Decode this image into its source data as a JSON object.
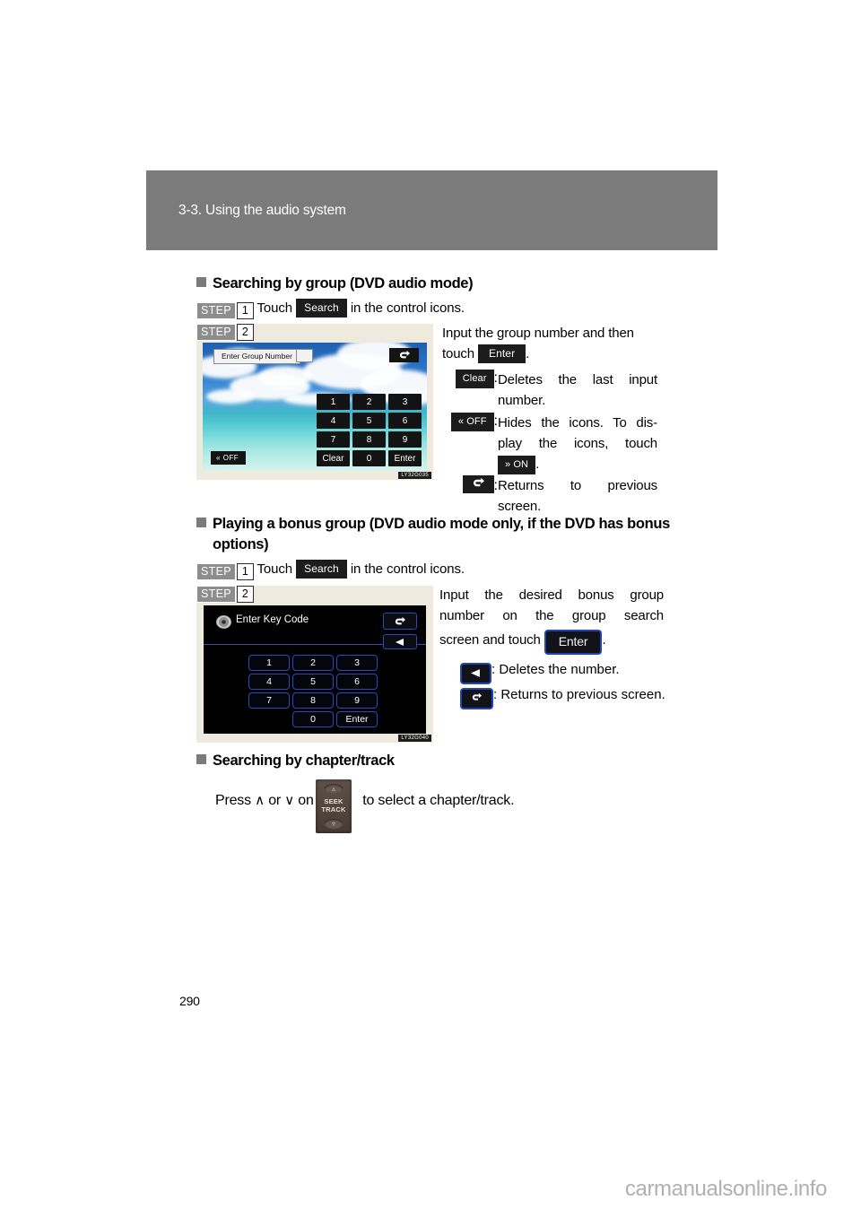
{
  "page": {
    "chapter_title": "3-3. Using the audio system",
    "page_number": "290",
    "watermark": "carmanualsonline.info"
  },
  "sections": [
    {
      "heading": "Searching by group (DVD audio mode)",
      "step1": {
        "badge_word": "STEP",
        "badge_num": "1",
        "pre": "Touch",
        "key": "Search",
        "post": "in the control icons."
      },
      "figure": {
        "badge_word": "STEP",
        "badge_num": "2",
        "code": "LY32G035",
        "field_label": "Enter Group Number",
        "back_icon": "back-arrow-icon",
        "off_label": "OFF",
        "off_icon": "double-chevron-left-icon",
        "keys": [
          "1",
          "2",
          "3",
          "4",
          "5",
          "6",
          "7",
          "8",
          "9",
          "Clear",
          "0",
          "Enter"
        ]
      },
      "body": {
        "intro_a": "Input the group number and then",
        "intro_b": "touch",
        "intro_key": "Enter",
        "intro_end": ".",
        "definitions": [
          {
            "key": "Clear",
            "key_type": "text",
            "text": "Deletes the last input number."
          },
          {
            "key": "OFF",
            "key_type": "off",
            "text_a": "Hides the icons. To dis-",
            "text_b": "play the icons, touch",
            "inline_key": "ON",
            "text_c": "."
          },
          {
            "key": "back-arrow-icon",
            "key_type": "icon",
            "text": "Returns to previous screen."
          }
        ]
      }
    },
    {
      "heading_a": "Playing a bonus group (DVD audio mode only, if the DVD has bonus",
      "heading_b": "options)",
      "step1": {
        "badge_word": "STEP",
        "badge_num": "1",
        "pre": "Touch",
        "key": "Search",
        "post": "in the control icons."
      },
      "figure": {
        "badge_word": "STEP",
        "badge_num": "2",
        "code": "LY32G040",
        "title": "Enter Key Code",
        "disc_icon": "disc-icon",
        "back_icon": "back-arrow-icon",
        "delete_icon": "left-triangle-icon",
        "keys": [
          "1",
          "2",
          "3",
          "4",
          "5",
          "6",
          "7",
          "8",
          "9",
          "",
          "0",
          "Enter"
        ]
      },
      "body": {
        "line_a": "Input the desired bonus group",
        "line_b": "number on the group search",
        "line_c": "screen and touch",
        "line_key": "Enter",
        "line_end": ".",
        "definitions": [
          {
            "key": "left-triangle-icon",
            "key_type": "icon-del",
            "text": ": Deletes the number."
          },
          {
            "key": "back-arrow-icon",
            "key_type": "icon-back",
            "text": ": Returns to previous screen."
          }
        ]
      }
    },
    {
      "heading": "Searching by chapter/track",
      "line_a": "Press",
      "up_glyph": "∧",
      "or_text": "or",
      "down_glyph": "∨",
      "on_text": "on",
      "button_label_a": "SEEK",
      "button_label_b": "TRACK",
      "line_b": "to select a chapter/track."
    }
  ]
}
